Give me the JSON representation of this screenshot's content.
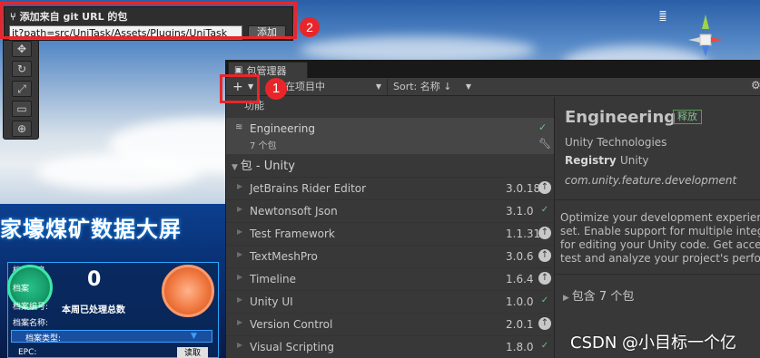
{
  "popup": {
    "title": "添加来自 git URL 的包",
    "url_value": "it?path=src/UniTask/Assets/Plugins/UniTask",
    "add_label": "添加",
    "callout": "2"
  },
  "package_manager": {
    "tab_title": "包管理器",
    "add_symbol": "+",
    "scope_label": "在项目中",
    "sort_label": "Sort: 名称 ↓",
    "callout": "1",
    "features_header": "功能",
    "feature": {
      "name": "Engineering",
      "count": "7 个包"
    },
    "group_header": "包 - Unity",
    "packages": [
      {
        "name": "JetBrains Rider Editor",
        "version": "3.0.18",
        "status": "update"
      },
      {
        "name": "Newtonsoft Json",
        "version": "3.1.0",
        "status": "installed"
      },
      {
        "name": "Test Framework",
        "version": "1.1.31",
        "status": "update"
      },
      {
        "name": "TextMeshPro",
        "version": "3.0.6",
        "status": "update"
      },
      {
        "name": "Timeline",
        "version": "1.6.4",
        "status": "update"
      },
      {
        "name": "Unity UI",
        "version": "1.0.0",
        "status": "installed"
      },
      {
        "name": "Version Control",
        "version": "2.0.1",
        "status": "update"
      },
      {
        "name": "Visual Scripting",
        "version": "1.8.0",
        "status": "installed"
      }
    ],
    "details": {
      "name": "Engineering",
      "badge": "释放",
      "author": "Unity Technologies",
      "registry_label": "Registry",
      "registry_value": "Unity",
      "package_id": "com.unity.feature.development",
      "description_lines": [
        "Optimize your development experience",
        "set. Enable support for multiple integrate",
        "for editing your Unity code. Get access",
        "test and analyze your project's performa"
      ],
      "contains": "包含 7 个包"
    }
  },
  "dashboard": {
    "title": "家壕煤矿数据大屏",
    "archive_info": "档案信息",
    "count": "0",
    "week_label": "本周已处理总数",
    "archive_name": "档案名称:",
    "archive_type": "档案类型:",
    "epc": "EPC:",
    "read_button": "读取",
    "field_1": "档案",
    "field_2": "档案编号:"
  },
  "watermark": "CSDN @小目标一个亿",
  "colors": {
    "callout_red": "#e8262a",
    "panel_bg": "#383838",
    "check_green": "#6fbf7e"
  }
}
